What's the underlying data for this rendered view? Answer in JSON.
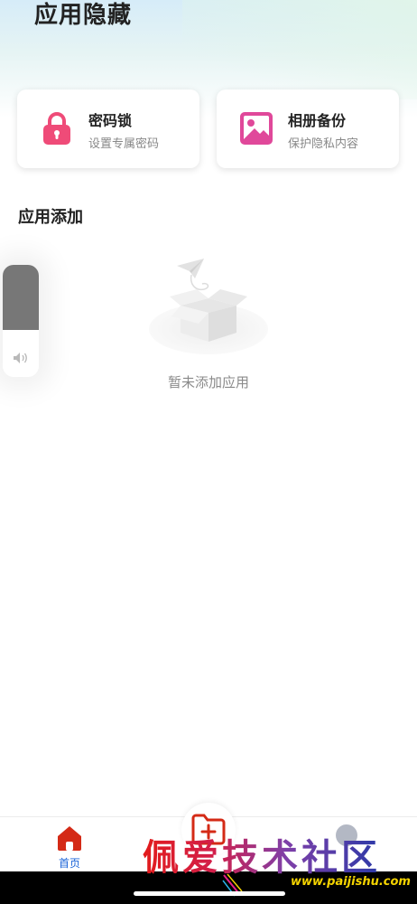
{
  "header": {
    "title": "应用隐藏"
  },
  "cards": [
    {
      "title": "密码锁",
      "subtitle": "设置专属密码",
      "icon": "lock-icon",
      "color": "#ef4b78"
    },
    {
      "title": "相册备份",
      "subtitle": "保护隐私内容",
      "icon": "image-icon",
      "color": "#e0489a"
    }
  ],
  "section": {
    "title": "应用添加"
  },
  "empty_state": {
    "text": "暂未添加应用",
    "icon": "empty-box-icon"
  },
  "volume_overlay": {
    "level": 0.58,
    "icon": "speaker-icon"
  },
  "bottom_nav": {
    "home_label": "首页",
    "home_color": "#d42a16",
    "active_label_color": "#1b64d8",
    "center_icon": "add-folder-icon",
    "center_color": "#d42a16",
    "mine_icon": "avatar"
  },
  "watermark": {
    "text": "佩爱技术社区",
    "url": "www.paijishu.com"
  }
}
